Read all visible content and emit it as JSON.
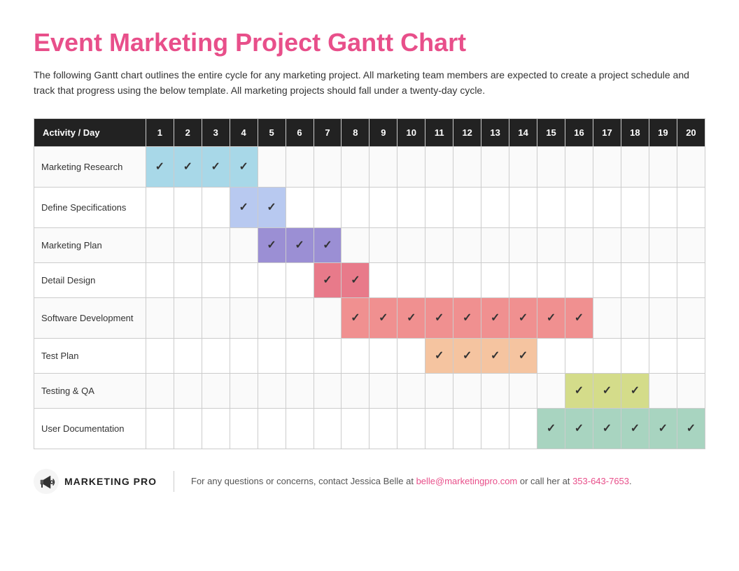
{
  "title": "Event Marketing Project Gantt Chart",
  "description": "The following Gantt chart outlines the entire cycle for any marketing project. All marketing team members are expected to create a project schedule and track that progress using the below template. All marketing projects should fall under a twenty-day cycle.",
  "header": {
    "activity_label": "Activity / Day",
    "days": [
      1,
      2,
      3,
      4,
      5,
      6,
      7,
      8,
      9,
      10,
      11,
      12,
      13,
      14,
      15,
      16,
      17,
      18,
      19,
      20
    ]
  },
  "rows": [
    {
      "name": "Marketing Research",
      "class": "row-marketing",
      "active_days": [
        1,
        2,
        3,
        4
      ]
    },
    {
      "name": "Define Specifications",
      "class": "row-define",
      "active_days": [
        4,
        5
      ]
    },
    {
      "name": "Marketing Plan",
      "class": "row-marketing-plan",
      "active_days": [
        5,
        6,
        7
      ]
    },
    {
      "name": "Detail Design",
      "class": "row-detail",
      "active_days": [
        7,
        8
      ]
    },
    {
      "name": "Software Development",
      "class": "row-software",
      "active_days": [
        8,
        9,
        10,
        11,
        12,
        13,
        14,
        15,
        16
      ]
    },
    {
      "name": "Test Plan",
      "class": "row-testplan",
      "active_days": [
        11,
        12,
        13,
        14
      ]
    },
    {
      "name": "Testing & QA",
      "class": "row-testing",
      "active_days": [
        16,
        17,
        18
      ]
    },
    {
      "name": "User Documentation",
      "class": "row-user-doc",
      "active_days": [
        15,
        16,
        17,
        18,
        19,
        20
      ]
    }
  ],
  "footer": {
    "logo_text": "MARKETING PRO",
    "contact_prefix": "For any questions or concerns, contact Jessica Belle at",
    "contact_email": "belle@marketingpro.com",
    "contact_middle": "or call her at",
    "contact_phone": "353-643-7653",
    "contact_suffix": "."
  }
}
